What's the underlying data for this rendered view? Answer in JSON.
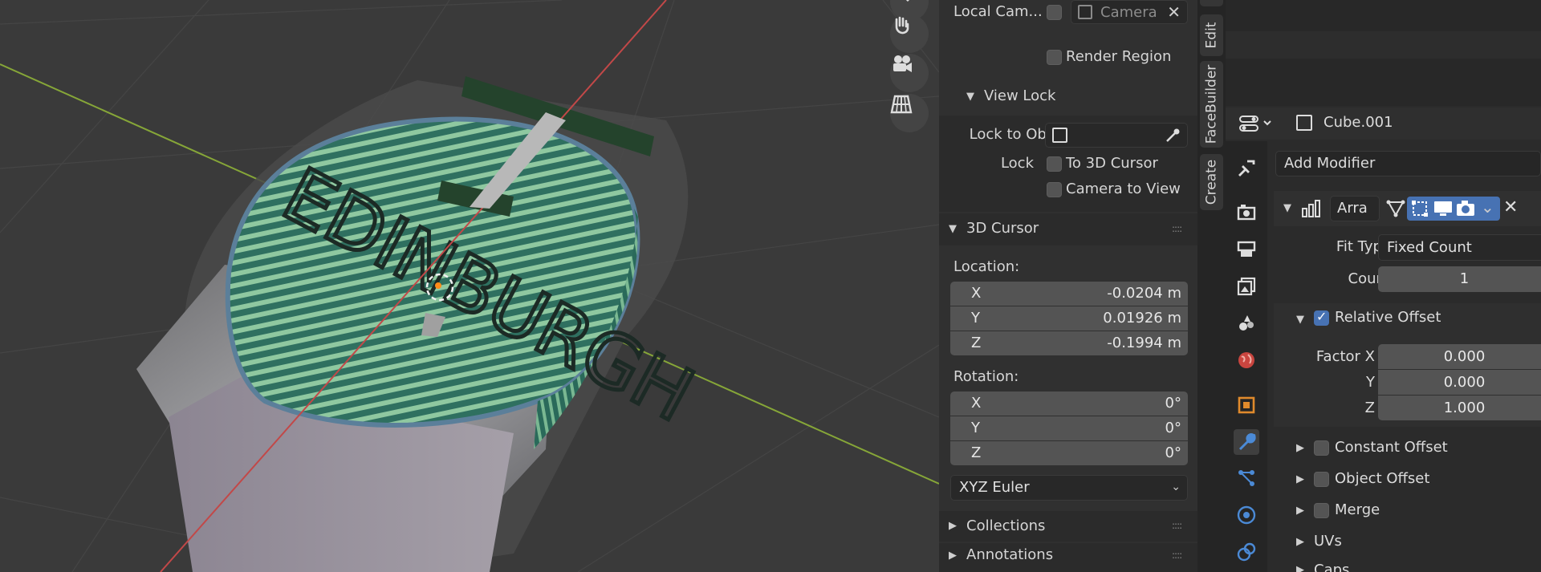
{
  "viewport": {
    "gizmo_icons": [
      "zoom-icon",
      "hand-icon",
      "camera-icon",
      "grid-icon"
    ],
    "scene_text": "EDINBURGH"
  },
  "view_panel": {
    "local_camera_label": "Local Cam...",
    "camera_field": "Camera",
    "render_region_label": "Render Region",
    "view_lock_header": "View Lock",
    "lock_to_object_label": "Lock to Obj...",
    "lock_label": "Lock",
    "to_3d_cursor_label": "To 3D Cursor",
    "camera_to_view_label": "Camera to View"
  },
  "cursor_panel": {
    "header": "3D Cursor",
    "location_label": "Location:",
    "location": [
      {
        "axis": "X",
        "value": "-0.0204 m"
      },
      {
        "axis": "Y",
        "value": "0.01926 m"
      },
      {
        "axis": "Z",
        "value": "-0.1994 m"
      }
    ],
    "rotation_label": "Rotation:",
    "rotation": [
      {
        "axis": "X",
        "value": "0°"
      },
      {
        "axis": "Y",
        "value": "0°"
      },
      {
        "axis": "Z",
        "value": "0°"
      }
    ],
    "rotation_mode": "XYZ Euler"
  },
  "collapsed_panels": [
    "Collections",
    "Annotations"
  ],
  "side_tabs": [
    "Edit",
    "FaceBuilder",
    "Create"
  ],
  "properties": {
    "object_name": "Cube.001",
    "add_modifier_label": "Add Modifier",
    "modifier_name": "Arra",
    "fit_type_label": "Fit Type",
    "fit_type_value": "Fixed Count",
    "count_label": "Count",
    "count_value": "1",
    "relative_offset_label": "Relative Offset",
    "factor_x_label": "Factor X",
    "factor_y_label": "Y",
    "factor_z_label": "Z",
    "factor_x": "0.000",
    "factor_y": "0.000",
    "factor_z": "1.000",
    "constant_offset_label": "Constant Offset",
    "object_offset_label": "Object Offset",
    "merge_label": "Merge",
    "uvs_label": "UVs",
    "caps_label": "Caps"
  },
  "colors": {
    "accent_blue": "#4772b3",
    "wrench_active": "#4b8ad6",
    "x_axis": "#c24848",
    "y_axis": "#86a638"
  }
}
